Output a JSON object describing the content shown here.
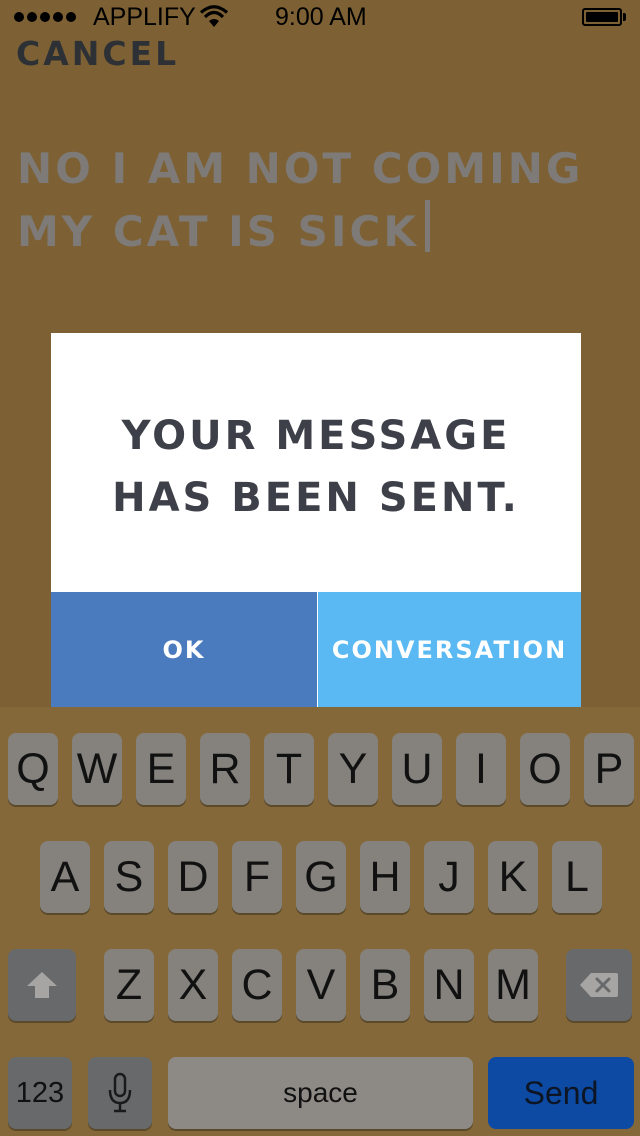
{
  "status_bar": {
    "carrier": "APPLIFY",
    "time": "9:00 AM",
    "battery_level": 1.0
  },
  "header": {
    "cancel_label": "CANCEL"
  },
  "compose": {
    "lines": [
      "NO I AM NOT COMING",
      "MY CAT IS SICK"
    ]
  },
  "modal": {
    "message_lines": [
      "YOUR MESSAGE",
      "HAS BEEN SENT."
    ],
    "ok_label": "OK",
    "conversation_label": "CONVERSATION"
  },
  "keyboard": {
    "row1": [
      "Q",
      "W",
      "E",
      "R",
      "T",
      "Y",
      "U",
      "I",
      "O",
      "P"
    ],
    "row2": [
      "A",
      "S",
      "D",
      "F",
      "G",
      "H",
      "J",
      "K",
      "L"
    ],
    "row3": [
      "Z",
      "X",
      "C",
      "V",
      "B",
      "N",
      "M"
    ],
    "numbers_label": "123",
    "space_label": "space",
    "send_label": "Send",
    "icons": {
      "shift": "shift-arrow-icon",
      "delete": "backspace-icon",
      "mic": "microphone-icon"
    }
  },
  "colors": {
    "background": "#7d6134",
    "ok_button": "#4a7bbf",
    "conversation_button": "#5ab9f2",
    "send_key": "#0c4aa3"
  }
}
